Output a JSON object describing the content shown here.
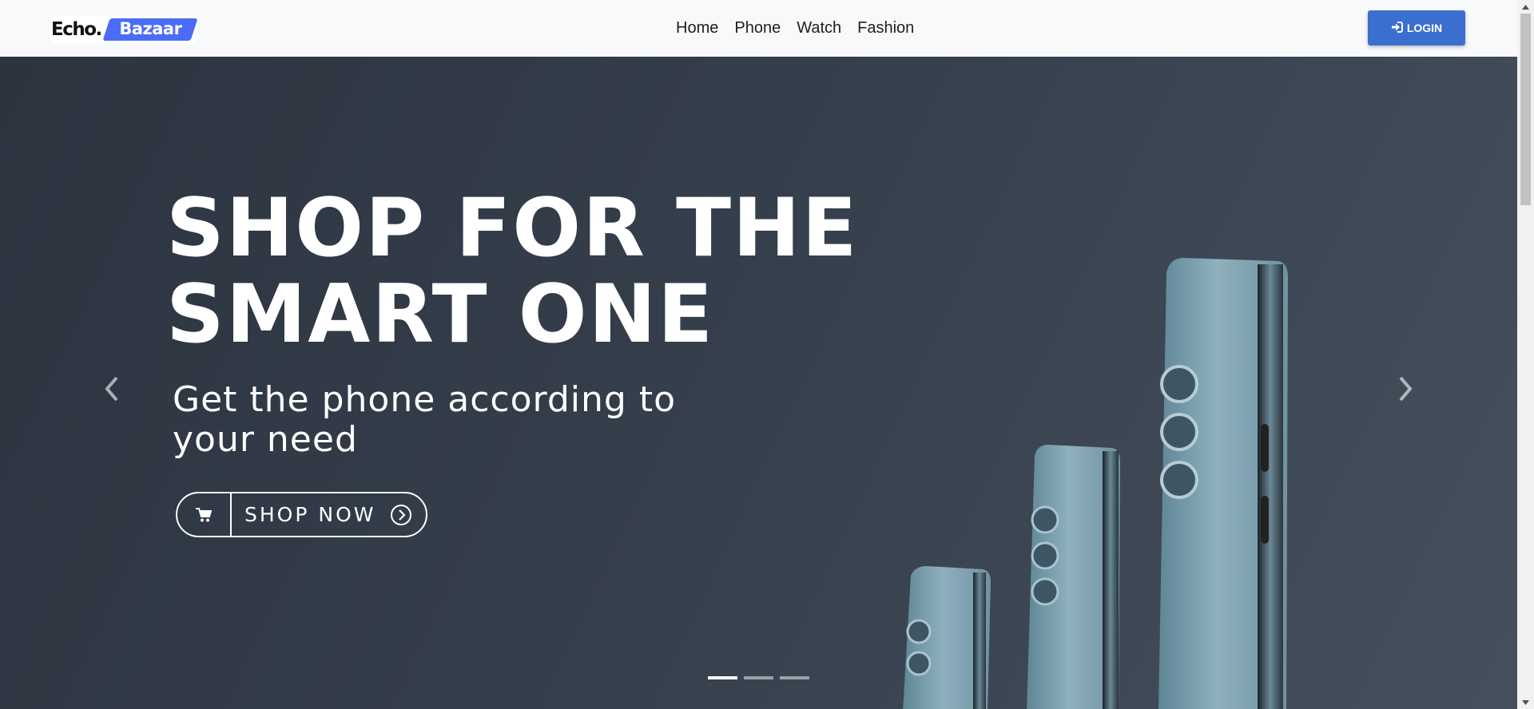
{
  "brand": {
    "part1": "Echo.",
    "part2": "Bazaar",
    "accent": "#4a6cf7"
  },
  "nav": {
    "items": [
      {
        "label": "Home"
      },
      {
        "label": "Phone"
      },
      {
        "label": "Watch"
      },
      {
        "label": "Fashion"
      }
    ],
    "login_label": "LOGIN",
    "login_color": "#3a6fd0"
  },
  "hero": {
    "title_line1": "SHOP FOR THE",
    "title_line2": "SMART ONE",
    "subtitle": "Get the phone according to your need",
    "cta_label": "SHOP NOW",
    "cta_icons": [
      "cart-icon",
      "circle-arrow-right-icon"
    ],
    "carousel": {
      "slide_count": 3,
      "active_index": 0
    }
  }
}
